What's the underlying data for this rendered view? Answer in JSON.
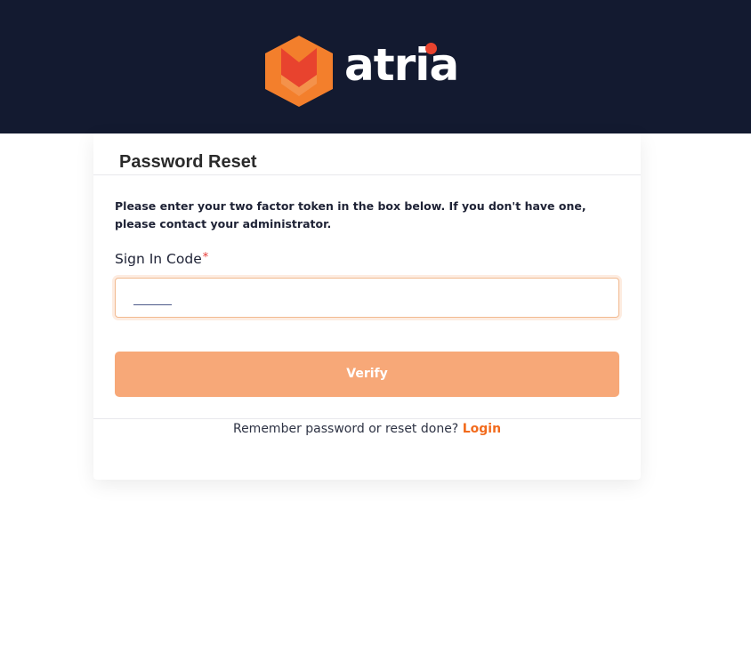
{
  "brand": {
    "name": "atria",
    "colors": {
      "header_background": "#131a30",
      "logo_orange": "#f37f2c",
      "logo_red": "#e8432e",
      "accent": "#f26b1d",
      "button": "#f7a878"
    },
    "logo_icon": "atria-shield-icon"
  },
  "card": {
    "title": "Password Reset",
    "instructions": "Please enter your two factor token in the box below. If you don't have one, please contact your administrator.",
    "field": {
      "label": "Sign In Code",
      "required_marker": "*",
      "value": ""
    },
    "verify_label": "Verify",
    "footer": {
      "prompt": "Remember password or reset done?",
      "link_label": "Login"
    }
  }
}
